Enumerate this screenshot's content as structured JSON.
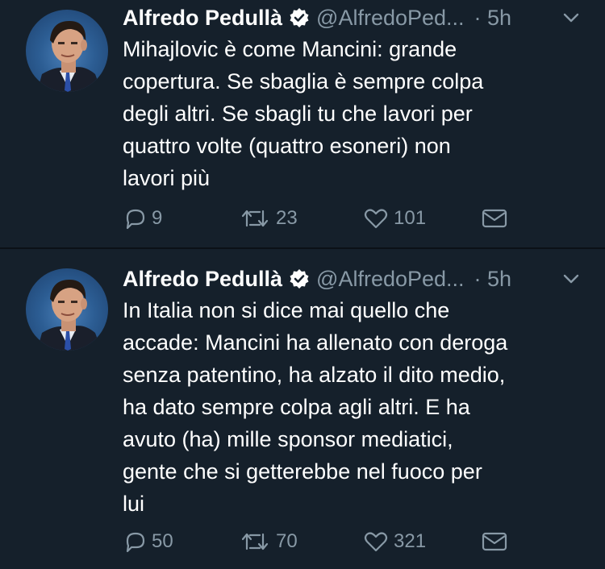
{
  "tweets": [
    {
      "author_name": "Alfredo Pedullà",
      "handle": "@AlfredoPed...",
      "time": "· 5h",
      "text_lines": [
        "Mihajlovic è come Mancini: grande",
        "copertura. Se sbaglia è sempre colpa",
        "degli altri. Se sbagli tu che lavori per",
        "quattro volte (quattro esoneri) non",
        "lavori più"
      ],
      "replies": "9",
      "retweets": "23",
      "likes": "101"
    },
    {
      "author_name": "Alfredo Pedullà",
      "handle": "@AlfredoPed...",
      "time": "· 5h",
      "text_lines": [
        "In Italia non si dice mai quello che",
        "accade: Mancini ha allenato con deroga",
        "senza patentino, ha alzato il dito medio,",
        "ha dato sempre colpa agli altri. E ha",
        "avuto (ha) mille sponsor mediatici,",
        "gente che si getterebbe nel fuoco per",
        "lui"
      ],
      "replies": "50",
      "retweets": "70",
      "likes": "321"
    }
  ],
  "colors": {
    "background": "#15202b",
    "text": "#ffffff",
    "secondary": "#8899a6",
    "verified_badge": "#ffffff"
  },
  "icons": [
    "verified-badge-icon",
    "chevron-down-icon",
    "reply-icon",
    "retweet-icon",
    "like-icon",
    "direct-message-icon"
  ]
}
